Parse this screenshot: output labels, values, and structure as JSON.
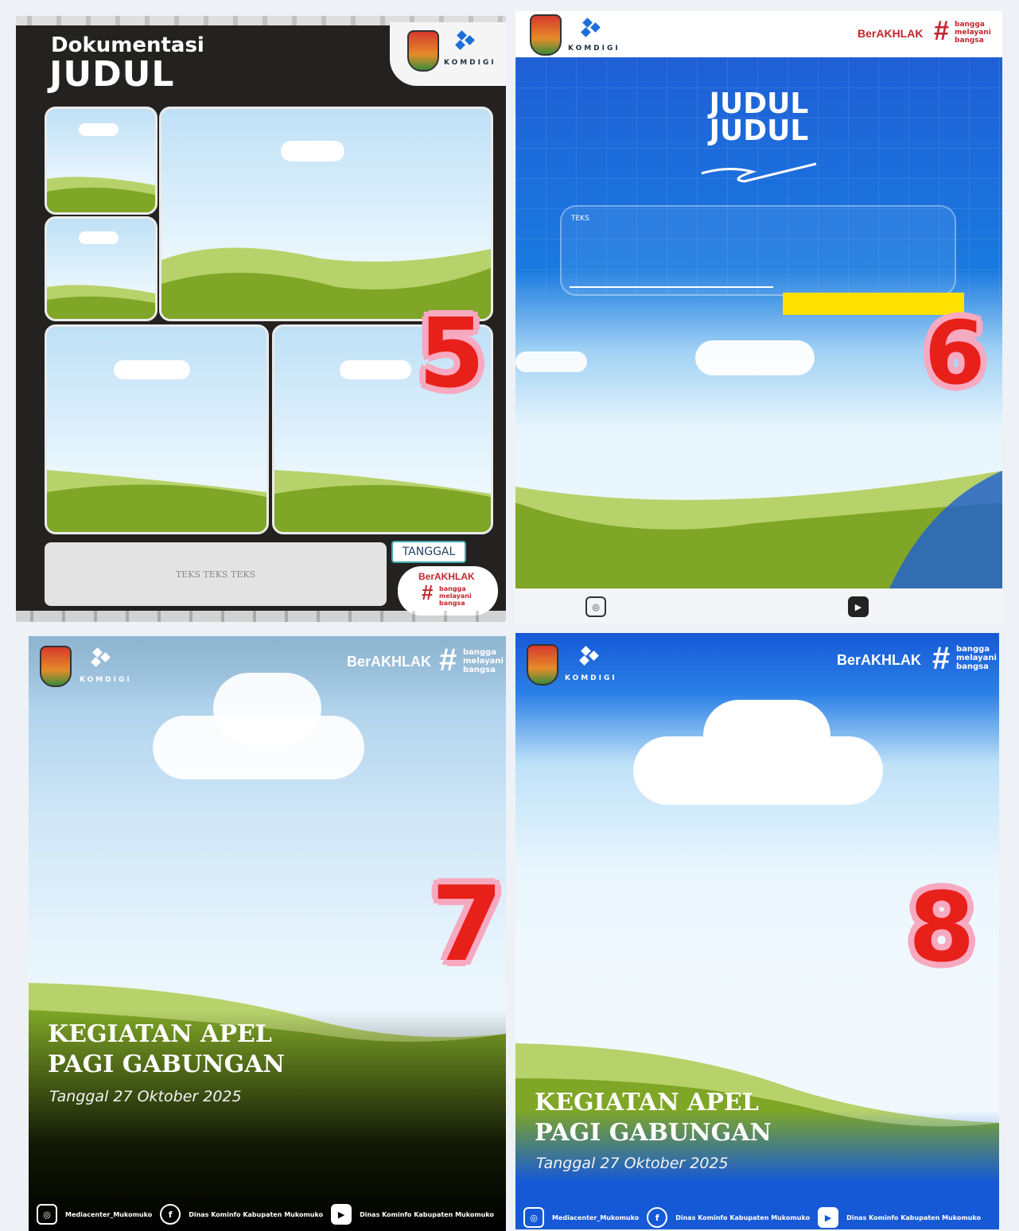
{
  "t5": {
    "title_small": "Dokumentasi",
    "title_big": "JUDUL",
    "date_label": "TANGGAL",
    "text_box": "TEKS TEKS TEKS",
    "number": "5",
    "kom": "KOMDIGI",
    "ber": "BerAKHLAK",
    "bangga": [
      "bangga",
      "melayani",
      "bangsa"
    ]
  },
  "t6": {
    "title_1": "JUDUL",
    "title_2": "JUDUL",
    "tag": "TEKS",
    "number": "6",
    "kom": "KOMDIGI",
    "ber": "BerAKHLAK",
    "bangga": [
      "bangga",
      "melayani",
      "bangsa"
    ]
  },
  "t7": {
    "title_1": "KEGIATAN APEL",
    "title_2": "PAGI GABUNGAN",
    "date": "Tanggal 27 Oktober 2025",
    "number": "7",
    "kom": "KOMDIGI",
    "ber": "BerAKHLAK",
    "bangga": [
      "bangga",
      "melayani",
      "bangsa"
    ],
    "footer": [
      "Mediacenter_Mukomuko",
      "Dinas Kominfo Kabupaten Mukomuko",
      "Dinas Kominfo Kabupaten Mukomuko"
    ]
  },
  "t8": {
    "title_1": "KEGIATAN APEL",
    "title_2": "PAGI GABUNGAN",
    "date": "Tanggal 27 Oktober 2025",
    "number": "8",
    "kom": "KOMDIGI",
    "ber": "BerAKHLAK",
    "bangga": [
      "bangga",
      "melayani",
      "bangsa"
    ],
    "footer": [
      "Mediacenter_Mukomuko",
      "Dinas Kominfo Kabupaten Mukomuko",
      "Dinas Kominfo Kabupaten Mukomuko"
    ]
  },
  "colors": {
    "accent_red": "#e8201a",
    "pink_outline": "#f7a9c0",
    "kom_blue": "#1d6fd8",
    "berakhlak_red": "#c4262e",
    "grass": "#7fa626",
    "grass_light": "#b7d26a",
    "dark_frame": "#242121",
    "blue_bg": "#1659d6"
  }
}
